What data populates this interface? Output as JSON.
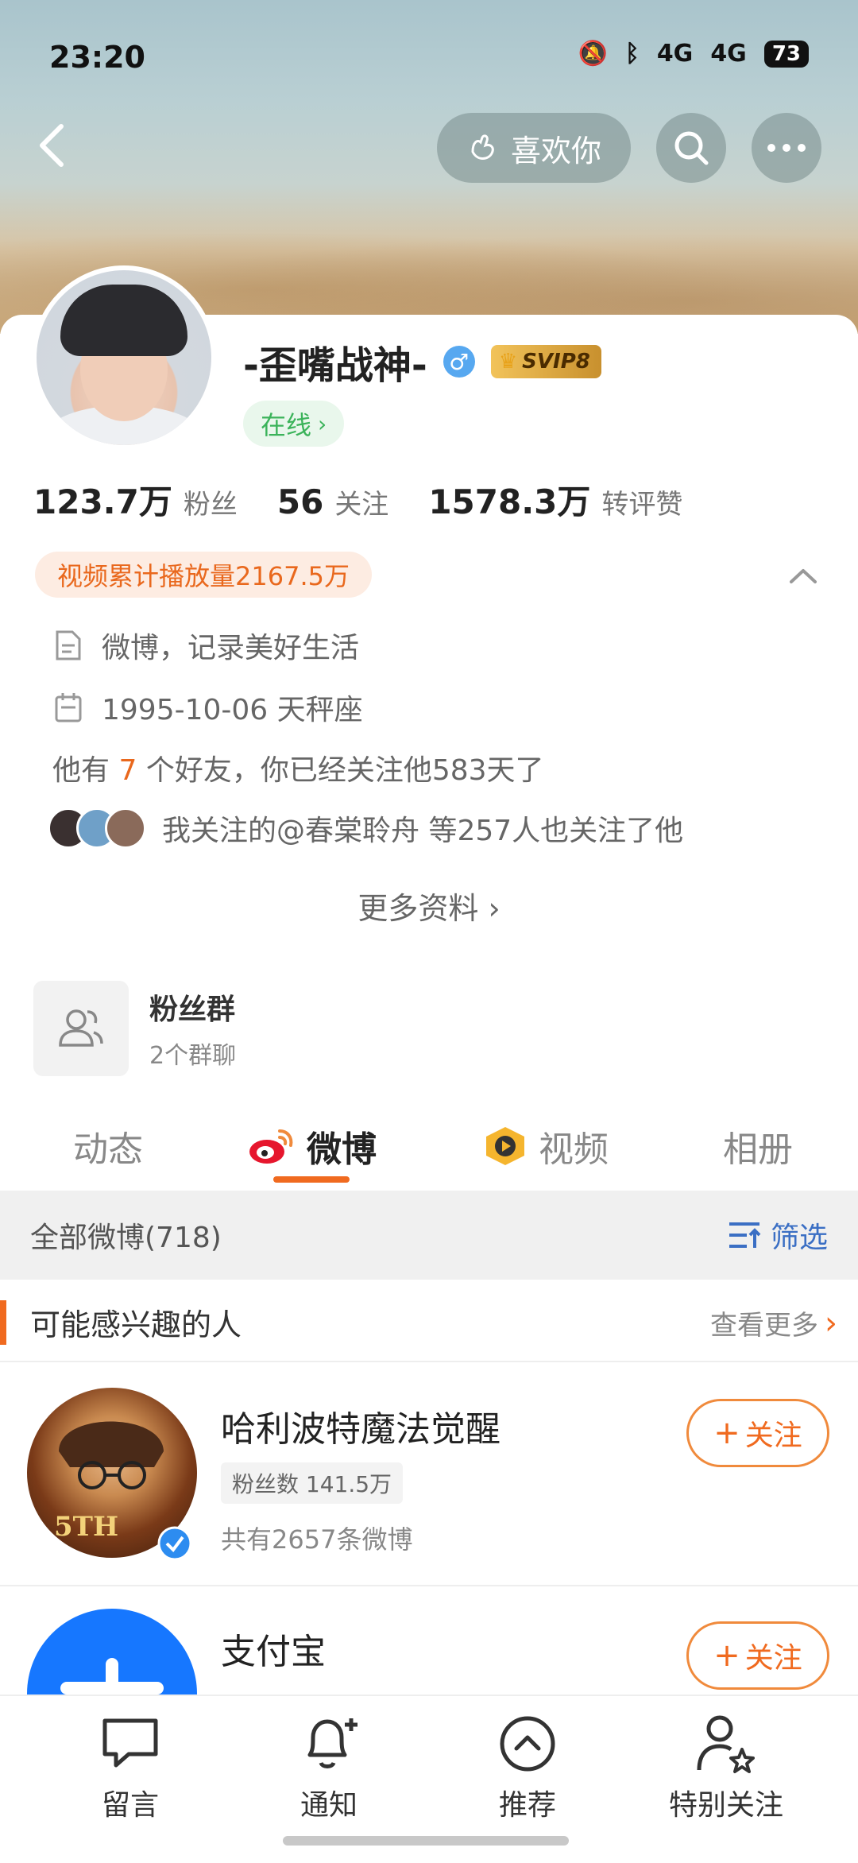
{
  "status_bar": {
    "time": "23:20",
    "network1": "4G",
    "network2": "4G",
    "battery": "73"
  },
  "nav": {
    "like_label": "喜欢你"
  },
  "profile": {
    "name": "-歪嘴战神-",
    "vip": "SVIP8",
    "online": "在线",
    "stats": [
      {
        "num": "123.7万",
        "label": "粉丝"
      },
      {
        "num": "56",
        "label": "关注"
      },
      {
        "num": "1578.3万",
        "label": "转评赞"
      }
    ],
    "play_count": "视频累计播放量2167.5万",
    "bio": "微博，记录美好生活",
    "birthday": "1995-10-06 天秤座",
    "friends_prefix": "他有",
    "friends_count": "7",
    "friends_suffix": "个好友，你已经关注他583天了",
    "mutual": "我关注的@春棠聆舟 等257人也关注了他",
    "more_info": "更多资料"
  },
  "fan_group": {
    "title": "粉丝群",
    "subtitle": "2个群聊"
  },
  "tabs": [
    "动态",
    "微博",
    "视频",
    "相册"
  ],
  "filter": {
    "all": "全部微博(718)",
    "filter_label": "筛选"
  },
  "recommend": {
    "title": "可能感兴趣的人",
    "more": "查看更多",
    "people": [
      {
        "name": "哈利波特魔法觉醒",
        "fans": "粉丝数 141.5万",
        "posts": "共有2657条微博",
        "follow": "关注"
      },
      {
        "name": "支付宝",
        "follow": "关注"
      }
    ]
  },
  "bottom": [
    "留言",
    "通知",
    "推荐",
    "特别关注"
  ],
  "colors": {
    "accent": "#f06a1f",
    "online": "#3bb35a",
    "link": "#3b6fc4"
  }
}
